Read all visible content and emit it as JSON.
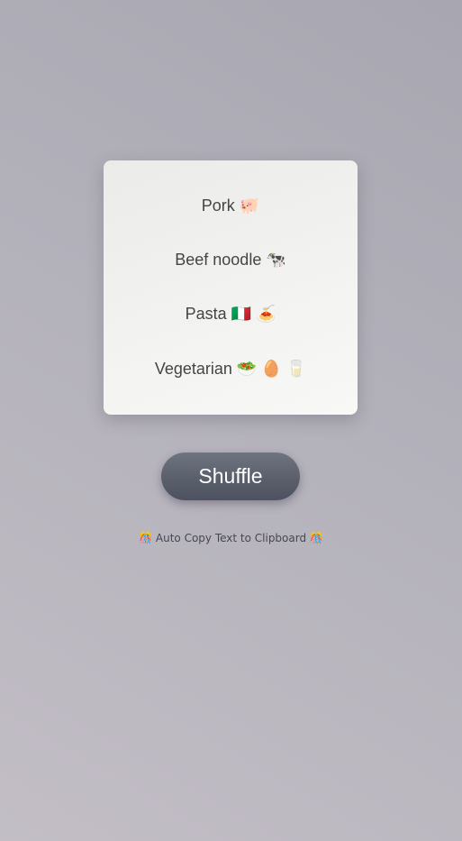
{
  "menu": {
    "items": [
      {
        "label": "Pork 🐖"
      },
      {
        "label": "Beef noodle 🐄"
      },
      {
        "label": "Pasta 🇮🇹 🍝"
      },
      {
        "label": "Vegetarian 🥗 🥚 🥛"
      }
    ]
  },
  "shuffle_button": {
    "label": "Shuffle"
  },
  "hint": {
    "text": "🎊 Auto Copy Text to Clipboard 🎊"
  }
}
